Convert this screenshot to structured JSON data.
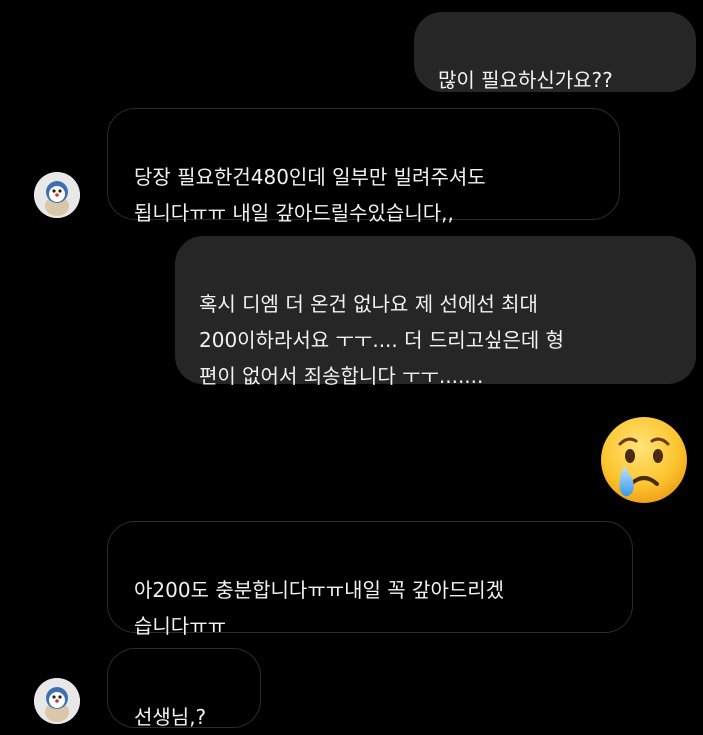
{
  "conversation": {
    "messages": [
      {
        "sender": "me",
        "text": "많이 필요하신가요??"
      },
      {
        "sender": "other",
        "text": "당장 필요한건480인데 일부만 빌려주셔도\n됩니다ㅠㅠ 내일 갚아드릴수있습니다,,"
      },
      {
        "sender": "me",
        "text": "혹시 디엠 더 온건 없나요 제 선에선 최대\n200이하라서요 ㅜㅜ.... 더 드리고싶은데 형\n편이 없어서 죄송합니다 ㅜㅜ......."
      },
      {
        "sender": "me",
        "emoji": "crying-face"
      },
      {
        "sender": "other",
        "text": "아200도 충분합니다ㅠㅠ내일 꼭 갚아드리겠\n습니다ㅠㅠ"
      },
      {
        "sender": "other",
        "text": "선생님,?"
      }
    ]
  },
  "colors": {
    "background": "#000000",
    "outgoing_bubble": "#262626",
    "incoming_bubble_border": "#2c2c2c",
    "text": "#f2f2f2"
  }
}
